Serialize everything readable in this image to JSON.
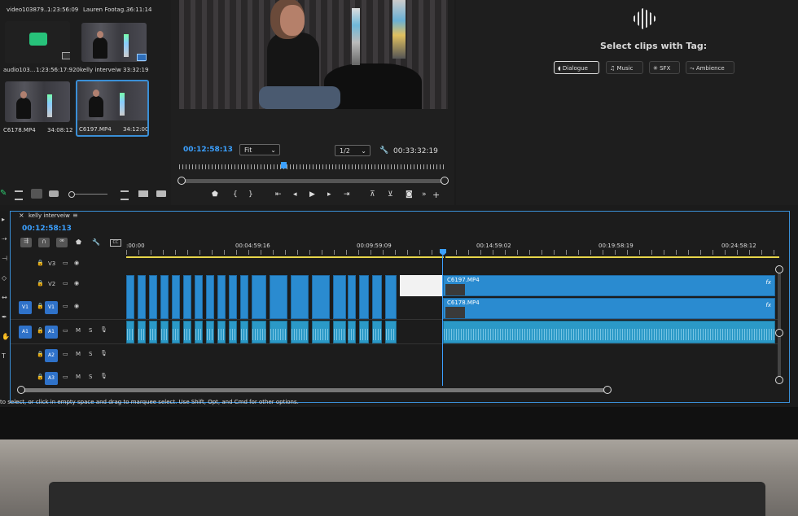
{
  "project_panel": {
    "clips": [
      {
        "name": "video103879...",
        "duration": "1:23:56:09"
      },
      {
        "name": "Lauren Footag...",
        "duration": "36:11:14"
      },
      {
        "name": "audio103...",
        "duration": "1:23:56:17:920"
      },
      {
        "name": "kelly interveiw",
        "duration": "33:32:19"
      },
      {
        "name": "C6178.MP4",
        "duration": "34:08:12"
      },
      {
        "name": "C6197.MP4",
        "duration": "34:12:00"
      }
    ]
  },
  "program_monitor": {
    "current_timecode": "00:12:58:13",
    "fit_label": "Fit",
    "resolution_label": "1/2",
    "duration": "00:33:32:19",
    "playhead_fraction": 0.39
  },
  "essential_sound": {
    "heading": "Select clips with Tag:",
    "tags": [
      "Dialogue",
      "Music",
      "SFX",
      "Ambience"
    ]
  },
  "timeline": {
    "sequence_name": "kelly interveiw",
    "timecode": "00:12:58:13",
    "ruler_labels": [
      ":00:00",
      "00:04:59:16",
      "00:09:59:09",
      "00:14:59:02",
      "00:19:58:19",
      "00:24:58:12"
    ],
    "tracks": [
      {
        "id": "v3",
        "label": "V3"
      },
      {
        "id": "v2",
        "label": "V2"
      },
      {
        "id": "v1",
        "label": "V1",
        "source": "V1"
      },
      {
        "id": "a1",
        "label": "A1",
        "source": "A1"
      },
      {
        "id": "a2",
        "label": "A2"
      },
      {
        "id": "a3",
        "label": "A3"
      }
    ],
    "clip_v2_label": "C6197.MP4",
    "clip_v1_label": "C6178.MP4",
    "fx_label": "fx",
    "mute_label": "M",
    "solo_label": "S"
  },
  "status_bar": {
    "text": "to select, or click in empty space and drag to marquee select. Use Shift, Opt, and Cmd for other options."
  },
  "colors": {
    "accent": "#2f8fe0",
    "clip_video": "#2a8bd0",
    "clip_audio": "#2b99c7",
    "ruler_yellow": "#e8d64a"
  }
}
